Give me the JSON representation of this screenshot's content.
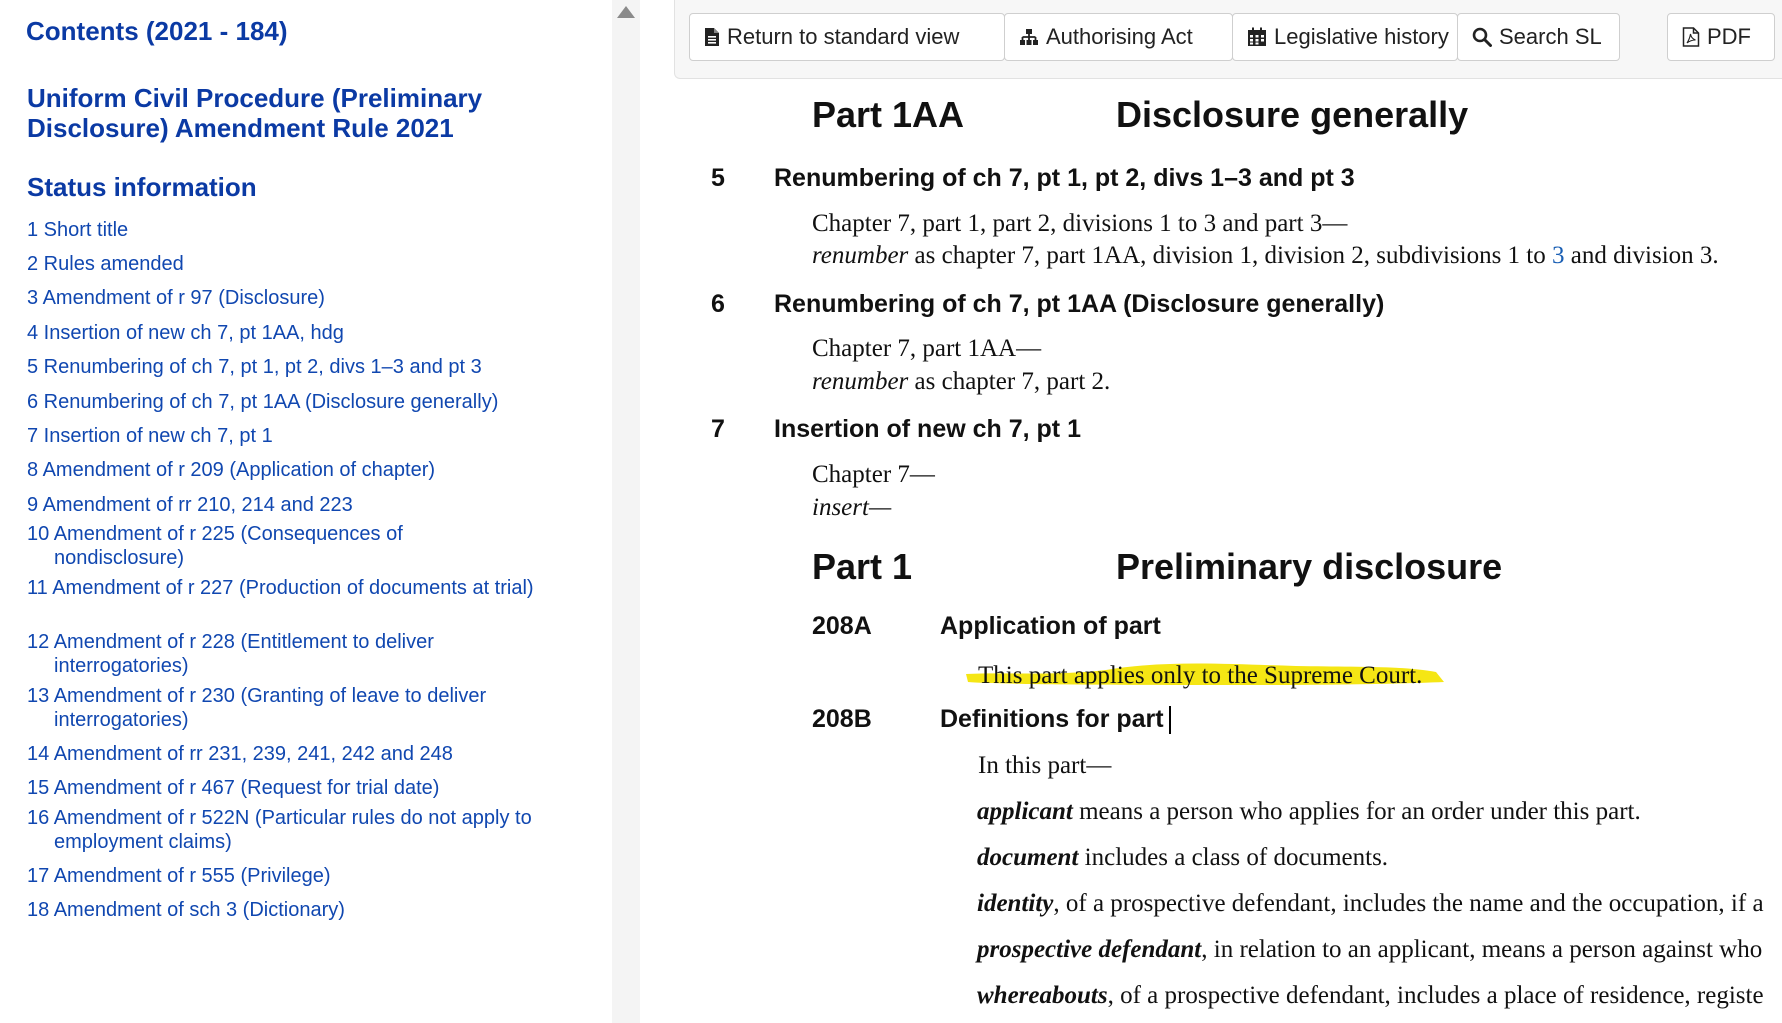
{
  "sidebar": {
    "contents_heading": "Contents (2021 - 184)",
    "title_line1": "Uniform Civil Procedure (Preliminary",
    "title_line2": "Disclosure) Amendment Rule 2021",
    "status_heading": "Status information",
    "toc": [
      "1 Short title",
      "2 Rules amended",
      "3 Amendment of r 97 (Disclosure)",
      "4 Insertion of new ch 7, pt 1AA, hdg",
      "5 Renumbering of ch 7, pt 1, pt 2, divs 1–3 and pt 3",
      "6 Renumbering of ch 7, pt 1AA (Disclosure generally)",
      "7 Insertion of new ch 7, pt 1",
      "8 Amendment of r 209 (Application of chapter)",
      "9 Amendment of rr 210, 214 and 223",
      "10 Amendment of r 225 (Consequences of nondisclosure)",
      "11 Amendment of r 227 (Production of documents at trial)",
      "12 Amendment of r 228 (Entitlement to deliver interrogatories)",
      "13 Amendment of r 230 (Granting of leave to deliver interrogatories)",
      "14 Amendment of rr 231, 239, 241, 242 and 248",
      "15 Amendment of r 467 (Request for trial date)",
      "16 Amendment of r 522N (Particular rules do not apply to employment claims)",
      "17 Amendment of r 555 (Privilege)",
      "18 Amendment of sch 3 (Dictionary)"
    ]
  },
  "toolbar": {
    "standard_view": "Return to standard view",
    "authorising_act": "Authorising Act",
    "legislative_history": "Legislative history",
    "search_sl": "Search SL",
    "pdf": "PDF"
  },
  "doc": {
    "part1aa_num": "Part 1AA",
    "part1aa_title": "Disclosure generally",
    "s5_num": "5",
    "s5_title": "Renumbering of ch 7, pt 1, pt 2, divs 1–3 and pt 3",
    "s5_line1": "Chapter 7, part 1, part 2, divisions 1 to 3 and part 3—",
    "s5_line2_italic": "renumber",
    "s5_line2_a": " as chapter 7, part 1AA, division 1, division 2, subdivisions 1 to ",
    "s5_line2_link": "3",
    "s5_line2_b": " and division 3.",
    "s6_num": "6",
    "s6_title": "Renumbering of ch 7, pt 1AA (Disclosure generally)",
    "s6_line1": "Chapter 7, part 1AA—",
    "s6_line2_italic": "renumber",
    "s6_line2_rest": " as chapter 7, part 2.",
    "s7_num": "7",
    "s7_title": "Insertion of new ch 7, pt 1",
    "s7_line1": "Chapter 7—",
    "s7_line2_italic": "insert—",
    "part1_num": "Part 1",
    "part1_title": "Preliminary disclosure",
    "r208a_num": "208A",
    "r208a_title": "Application of part",
    "r208a_text": "This part applies only to the Supreme Court.",
    "r208b_num": "208B",
    "r208b_title": "Definitions for part",
    "r208b_intro": "In this part—",
    "defs": [
      {
        "term": "applicant",
        "text": " means a person who applies for an order under this part."
      },
      {
        "term": "document",
        "text": " includes a class of documents."
      },
      {
        "term": "identity",
        "text": ", of a prospective defendant, includes the name and the occupation, if a"
      },
      {
        "term": "prospective defendant",
        "text": ", in relation to an applicant, means a person against who"
      },
      {
        "term": "whereabouts",
        "text": ", of a prospective defendant, includes a place of residence, registe"
      }
    ]
  },
  "colors": {
    "sidebar_link": "#1047b0",
    "sidebar_heading": "#0b3aa4",
    "highlight": "#f4e400"
  }
}
